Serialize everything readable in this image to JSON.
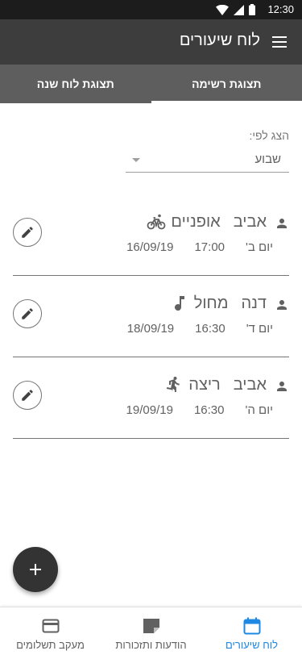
{
  "status_bar": {
    "time": "12:30"
  },
  "app_bar": {
    "title": "לוח שיעורים"
  },
  "tabs": [
    {
      "label": "תצוגת רשימה",
      "active": true
    },
    {
      "label": "תצוגת לוח שנה",
      "active": false
    }
  ],
  "filter": {
    "label": "הצג לפי:",
    "selected": "שבוע"
  },
  "lessons": [
    {
      "student": "אביב",
      "lesson": "אופניים",
      "icon": "bike-icon",
      "day": "יום ב'",
      "time": "17:00",
      "date": "16/09/19"
    },
    {
      "student": "דנה",
      "lesson": "מחול",
      "icon": "music-note-icon",
      "day": "יום ד'",
      "time": "16:30",
      "date": "18/09/19"
    },
    {
      "student": "אביב",
      "lesson": "ריצה",
      "icon": "running-icon",
      "day": "יום ה'",
      "time": "16:30",
      "date": "19/09/19"
    }
  ],
  "fab": {
    "icon": "plus-icon"
  },
  "bottom_nav": [
    {
      "label": "לוח שיעורים",
      "icon": "calendar-icon",
      "active": true
    },
    {
      "label": "הודעות ותזכורות",
      "icon": "note-icon",
      "active": false
    },
    {
      "label": "מעקב תשלומים",
      "icon": "credit-card-icon",
      "active": false
    }
  ],
  "colors": {
    "app_bar": "#3d3d3d",
    "tabs": "#5e5e5e",
    "accent": "#1e88e5",
    "text": "#616161"
  }
}
